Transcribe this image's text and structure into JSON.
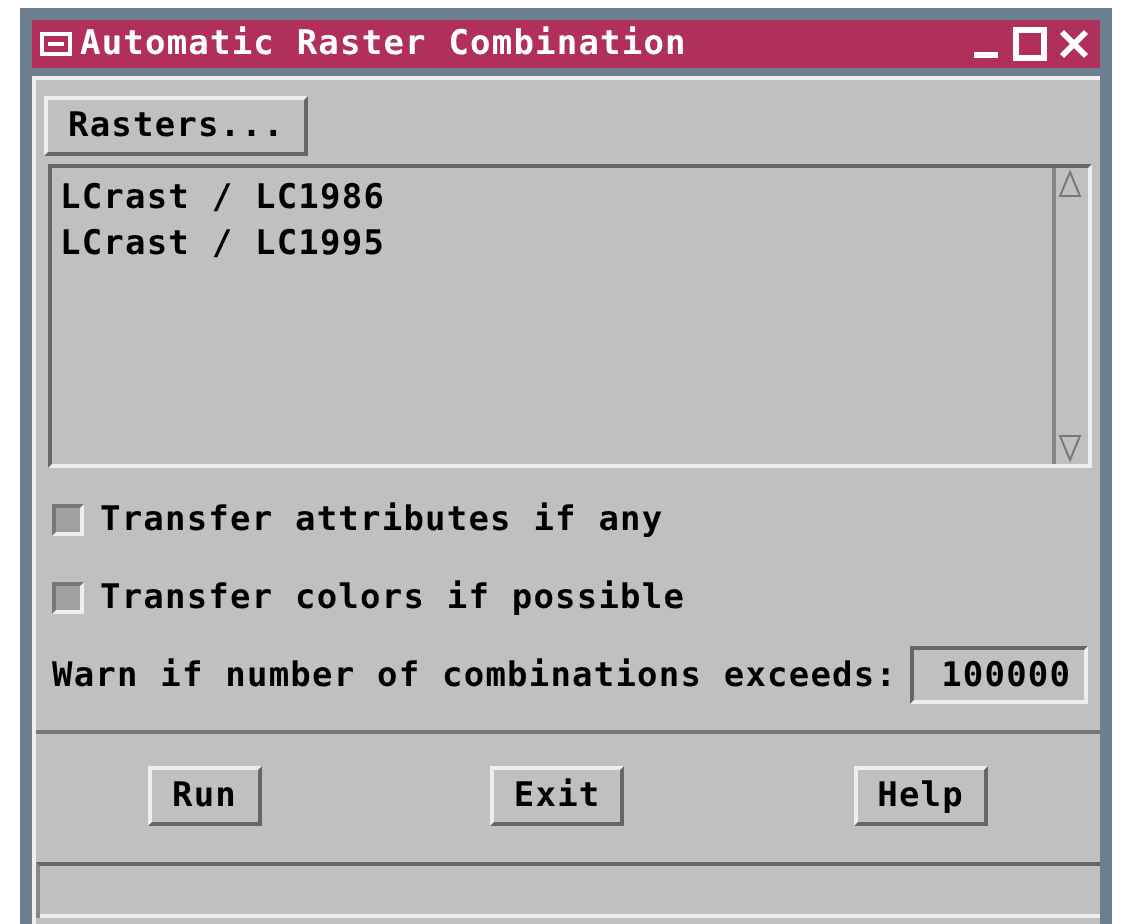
{
  "window": {
    "title": "Automatic Raster Combination"
  },
  "rasters_button": "Rasters...",
  "raster_list": [
    "LCrast / LC1986",
    "LCrast / LC1995"
  ],
  "options": [
    {
      "label": "Transfer attributes if any",
      "checked": false
    },
    {
      "label": "Transfer colors if possible",
      "checked": false
    }
  ],
  "warn": {
    "label": "Warn if number of combinations exceeds:",
    "value": "100000"
  },
  "buttons": [
    "Run",
    "Exit",
    "Help"
  ]
}
